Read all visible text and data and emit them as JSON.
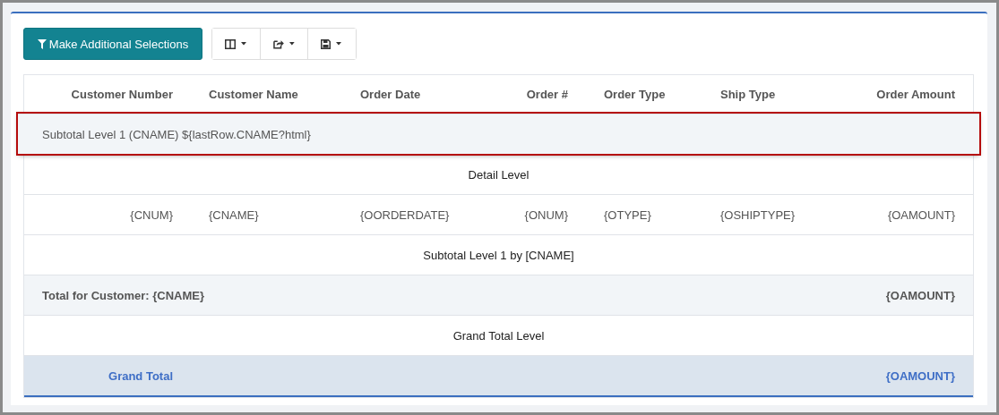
{
  "toolbar": {
    "primary_button": "Make Additional Selections",
    "icon_buttons": [
      {
        "kind": "columns"
      },
      {
        "kind": "export"
      },
      {
        "kind": "save"
      }
    ]
  },
  "table": {
    "columns": [
      "Customer Number",
      "Customer Name",
      "Order Date",
      "Order #",
      "Order Type",
      "Ship Type",
      "Order Amount"
    ],
    "rows": [
      {
        "kind": "group",
        "label": "Subtotal Level 1 (CNAME) ${lastRow.CNAME?html}",
        "highlighted": true
      },
      {
        "kind": "section",
        "text": "Detail Level"
      },
      {
        "kind": "detail",
        "cells": [
          "{CNUM}",
          "{CNAME}",
          "{OORDERDATE}",
          "{ONUM}",
          "{OTYPE}",
          "{OSHIPTYPE}",
          "{OAMOUNT}"
        ]
      },
      {
        "kind": "section",
        "text": "Subtotal Level 1 by [CNAME]"
      },
      {
        "kind": "total",
        "label": "Total for Customer: {CNAME}",
        "amount": "{OAMOUNT}"
      },
      {
        "kind": "section",
        "text": "Grand Total Level"
      },
      {
        "kind": "grand",
        "label": "Grand Total",
        "amount": "{OAMOUNT}"
      }
    ]
  }
}
